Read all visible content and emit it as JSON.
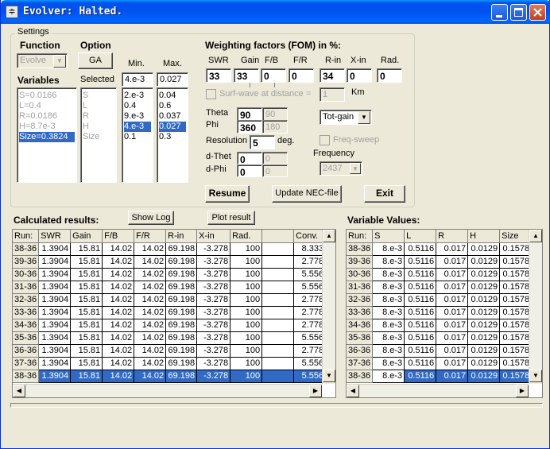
{
  "window": {
    "title": "Evolver: Halted."
  },
  "settings": {
    "group_title": "Settings",
    "function_label": "Function",
    "function_value": "Evolve",
    "option_label": "Option",
    "option_button": "GA",
    "variables_label": "Variables",
    "variables": [
      "S=0.0166",
      "L=0.4",
      "R=0.0186",
      "H=8.7e-3",
      "Size=0.3824"
    ],
    "selected_label": "Selected",
    "selected": [
      "S",
      "L",
      "R",
      "H",
      "Size"
    ],
    "min_label": "Min.",
    "min_value": "4.e-3",
    "min_list": [
      "2.e-3",
      "0.4",
      "9.e-3",
      "4.e-3",
      "0.1"
    ],
    "max_label": "Max.",
    "max_value": "0.027",
    "max_list": [
      "0.04",
      "0.6",
      "0.037",
      "0.027",
      "0.3"
    ]
  },
  "weighting": {
    "title": "Weighting factors (FOM) in %:",
    "headers": [
      "SWR",
      "Gain",
      "F/B",
      "F/R",
      "R-in",
      "X-in",
      "Rad."
    ],
    "values": [
      "33",
      "33",
      "0",
      "0",
      "34",
      "0",
      "0"
    ],
    "surfwave_label": "Surf-wave at distance =",
    "surfwave_value": "1",
    "km_label": "Km",
    "theta_label": "Theta",
    "theta_value": "90",
    "theta_value2": "90",
    "phi_label": "Phi",
    "phi_value": "360",
    "phi_value2": "180",
    "gain_mode": "Tot-gain",
    "freq_sweep_label": "Freq-sweep",
    "resolution_label": "Resolution",
    "resolution_value": "5",
    "deg_label": "deg.",
    "frequency_label": "Frequency",
    "frequency_value": "2437",
    "dthet_label": "d-Thet",
    "dthet_value": "0",
    "dthet_value2": "0",
    "dphi_label": "d-Phi",
    "dphi_value": "0",
    "dphi_value2": "0"
  },
  "buttons": {
    "resume": "Resume",
    "update_nec": "Update NEC-file",
    "exit": "Exit",
    "show_log": "Show Log",
    "plot_result": "Plot result"
  },
  "results": {
    "title": "Calculated results:",
    "columns": [
      "Run:",
      "SWR",
      "Gain",
      "F/B",
      "F/R",
      "R-in",
      "X-in",
      "Rad.",
      "",
      "Conv."
    ],
    "rows": [
      [
        "38-36",
        "1.3904",
        "15.81",
        "14.02",
        "14.02",
        "69.198",
        "-3.278",
        "100",
        "",
        "8.333"
      ],
      [
        "39-36",
        "1.3904",
        "15.81",
        "14.02",
        "14.02",
        "69.198",
        "-3.278",
        "100",
        "",
        "2.778"
      ],
      [
        "30-36",
        "1.3904",
        "15.81",
        "14.02",
        "14.02",
        "69.198",
        "-3.278",
        "100",
        "",
        "5.556"
      ],
      [
        "31-36",
        "1.3904",
        "15.81",
        "14.02",
        "14.02",
        "69.198",
        "-3.278",
        "100",
        "",
        "5.556"
      ],
      [
        "32-36",
        "1.3904",
        "15.81",
        "14.02",
        "14.02",
        "69.198",
        "-3.278",
        "100",
        "",
        "2.778"
      ],
      [
        "33-36",
        "1.3904",
        "15.81",
        "14.02",
        "14.02",
        "69.198",
        "-3.278",
        "100",
        "",
        "2.778"
      ],
      [
        "34-36",
        "1.3904",
        "15.81",
        "14.02",
        "14.02",
        "69.198",
        "-3.278",
        "100",
        "",
        "2.778"
      ],
      [
        "35-36",
        "1.3904",
        "15.81",
        "14.02",
        "14.02",
        "69.198",
        "-3.278",
        "100",
        "",
        "5.556"
      ],
      [
        "36-36",
        "1.3904",
        "15.81",
        "14.02",
        "14.02",
        "69.198",
        "-3.278",
        "100",
        "",
        "2.778"
      ],
      [
        "37-36",
        "1.3904",
        "15.81",
        "14.02",
        "14.02",
        "69.198",
        "-3.278",
        "100",
        "",
        "5.556"
      ],
      [
        "38-36",
        "1.3904",
        "15.81",
        "14.02",
        "14.02",
        "69.198",
        "-3.278",
        "100",
        "",
        "5.556"
      ]
    ],
    "selected_row": 10
  },
  "variable_values": {
    "title": "Variable Values:",
    "columns": [
      "Run:",
      "S",
      "L",
      "R",
      "H",
      "Size"
    ],
    "rows": [
      [
        "38-36",
        "8.e-3",
        "0.5116",
        "0.017",
        "0.0129",
        "0.1578"
      ],
      [
        "39-36",
        "8.e-3",
        "0.5116",
        "0.017",
        "0.0129",
        "0.1578"
      ],
      [
        "30-36",
        "8.e-3",
        "0.5116",
        "0.017",
        "0.0129",
        "0.1578"
      ],
      [
        "31-36",
        "8.e-3",
        "0.5116",
        "0.017",
        "0.0129",
        "0.1578"
      ],
      [
        "32-36",
        "8.e-3",
        "0.5116",
        "0.017",
        "0.0129",
        "0.1578"
      ],
      [
        "33-36",
        "8.e-3",
        "0.5116",
        "0.017",
        "0.0129",
        "0.1578"
      ],
      [
        "34-36",
        "8.e-3",
        "0.5116",
        "0.017",
        "0.0129",
        "0.1578"
      ],
      [
        "35-36",
        "8.e-3",
        "0.5116",
        "0.017",
        "0.0129",
        "0.1578"
      ],
      [
        "36-36",
        "8.e-3",
        "0.5116",
        "0.017",
        "0.0129",
        "0.1578"
      ],
      [
        "37-36",
        "8.e-3",
        "0.5116",
        "0.017",
        "0.0129",
        "0.1578"
      ],
      [
        "38-36",
        "8.e-3",
        "0.5116",
        "0.017",
        "0.0129",
        "0.1578"
      ]
    ],
    "selected_row": 10
  },
  "colors": {
    "titlebar": "#0054e3",
    "selection": "#316ac5",
    "face": "#ece9d8"
  }
}
